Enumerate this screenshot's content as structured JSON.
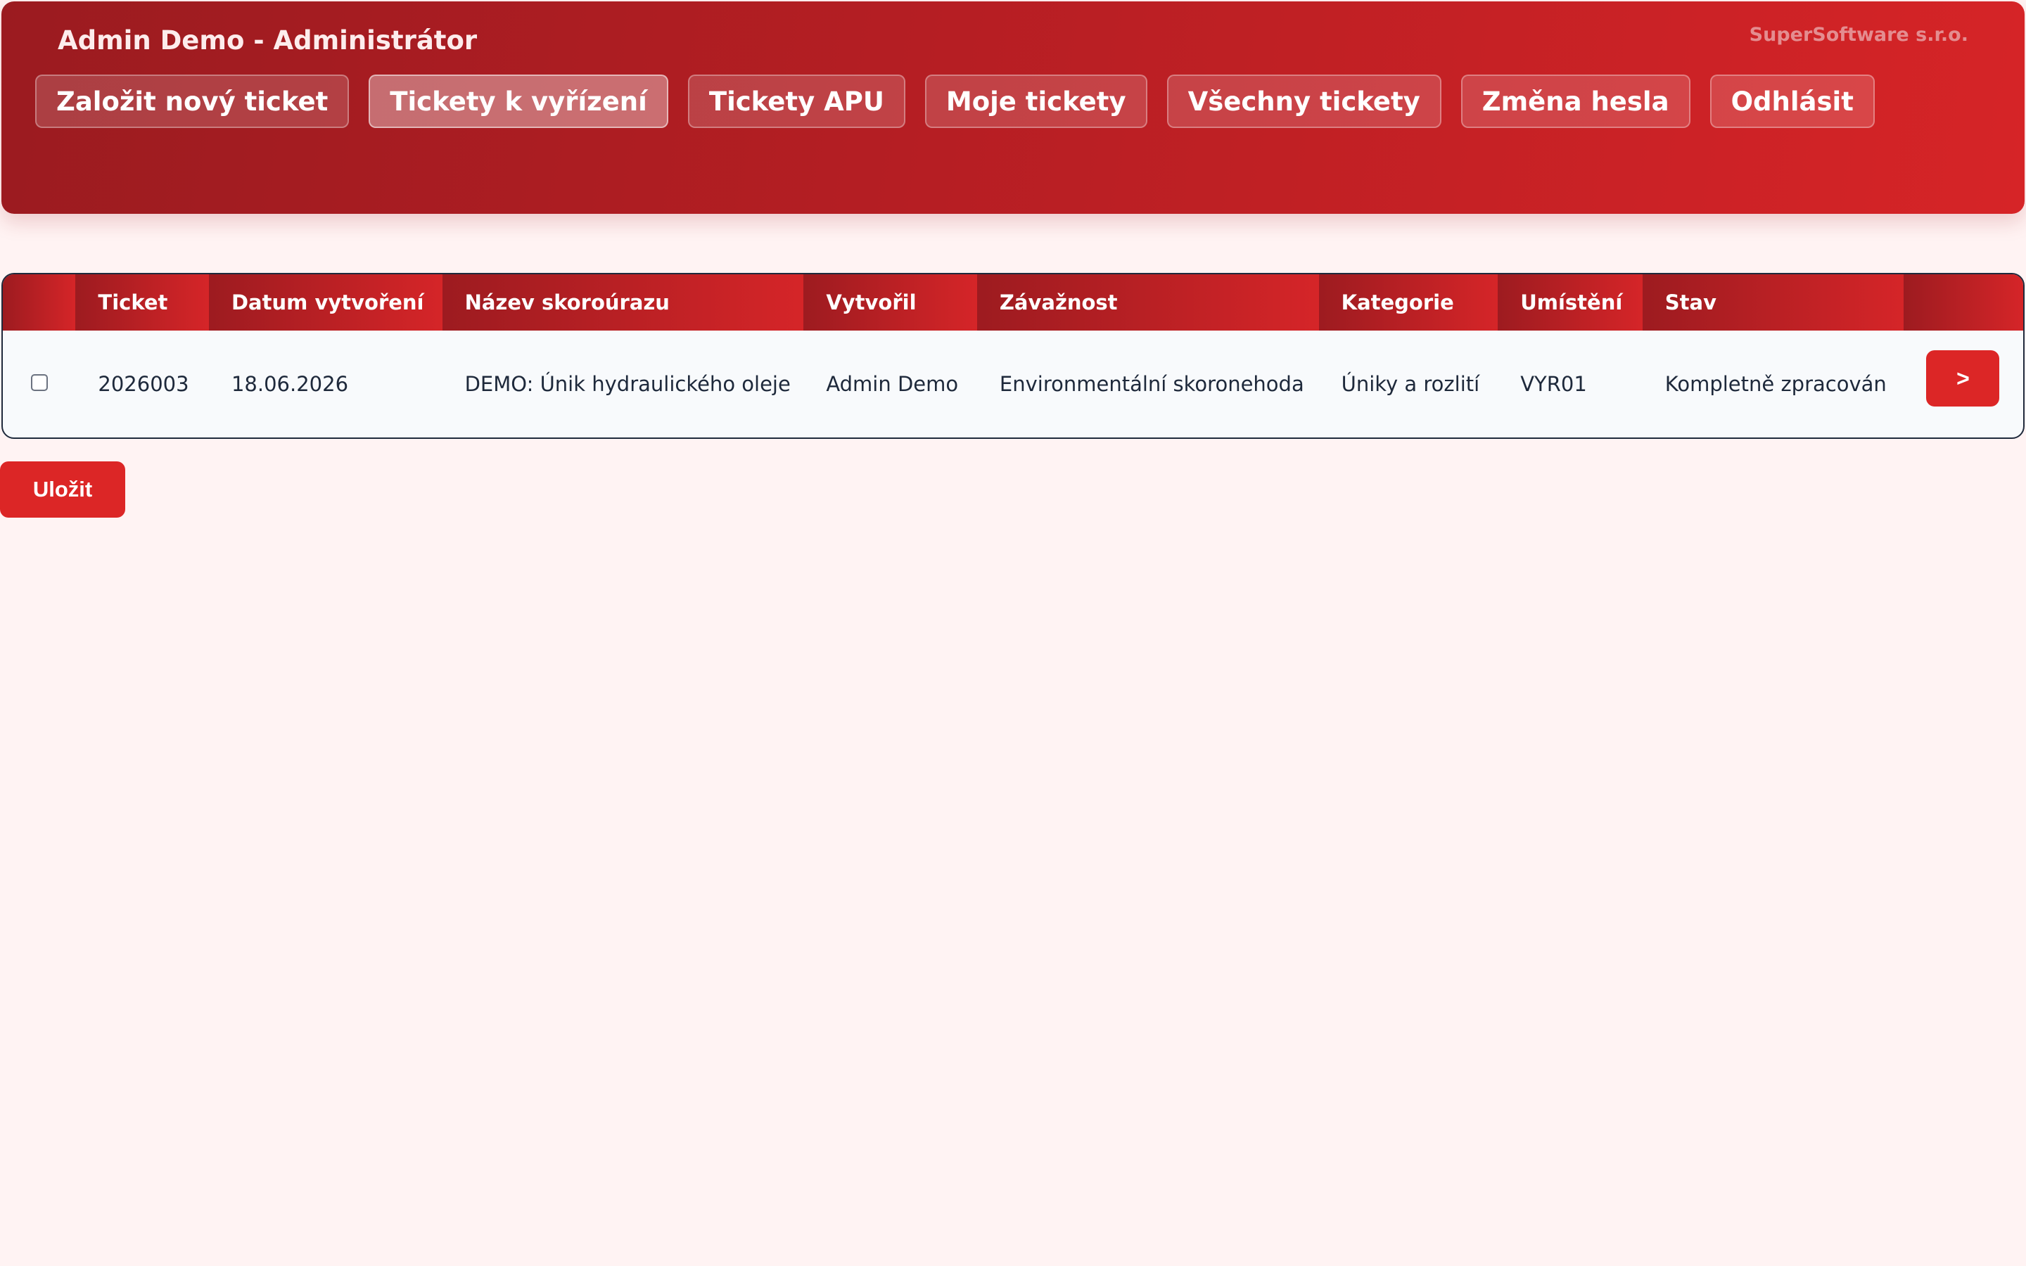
{
  "header": {
    "title": "Admin Demo - Administrátor",
    "brand": "SuperSoftware s.r.o.",
    "nav": [
      {
        "label": "Založit nový ticket",
        "active": false
      },
      {
        "label": "Tickety k vyřízení",
        "active": true
      },
      {
        "label": "Tickety APU",
        "active": false
      },
      {
        "label": "Moje tickety",
        "active": false
      },
      {
        "label": "Všechny tickety",
        "active": false
      },
      {
        "label": "Změna hesla",
        "active": false
      },
      {
        "label": "Odhlásit",
        "active": false
      }
    ]
  },
  "table": {
    "columns": [
      "Ticket",
      "Datum vytvoření",
      "Název skoroúrazu",
      "Vytvořil",
      "Závažnost",
      "Kategorie",
      "Umístění",
      "Stav"
    ],
    "rows": [
      {
        "ticket": "2026003",
        "date": "18.06.2026",
        "name": "DEMO: Únik hydraulického oleje",
        "created_by": "Admin Demo",
        "severity": "Environmentální skoronehoda",
        "category": "Úniky a rozlití",
        "location": "VYR01",
        "status": "Kompletně zpracován",
        "open_label": ">"
      }
    ]
  },
  "save_label": "Uložit",
  "colors": {
    "accent": "#dc2626",
    "header_dark": "#9b1b20",
    "background": "#fff3f3"
  }
}
